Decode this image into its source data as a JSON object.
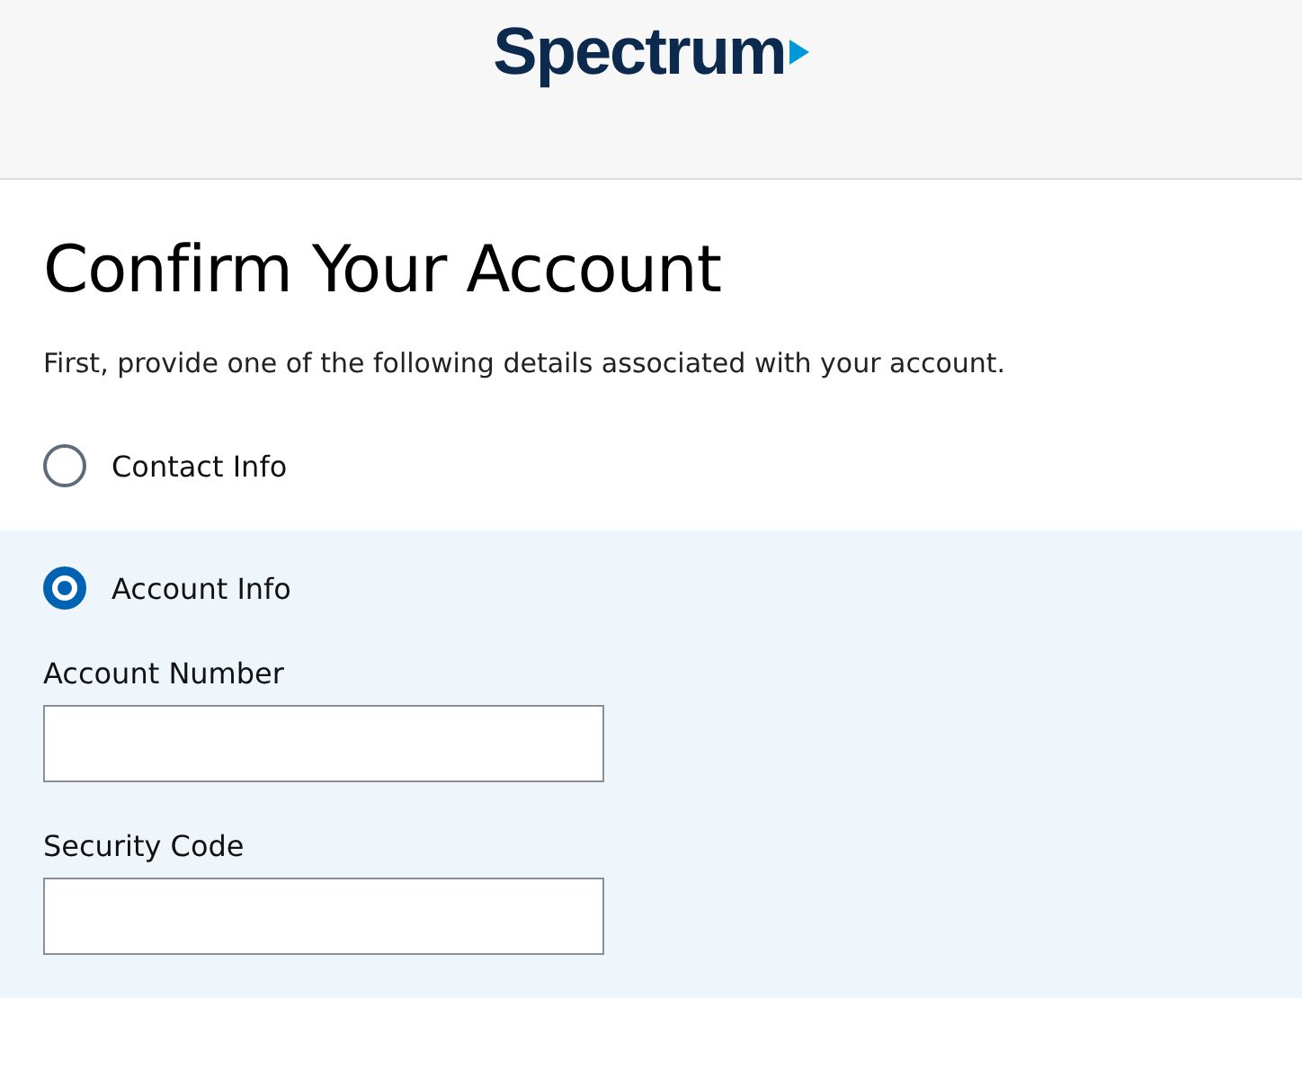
{
  "header": {
    "logo": "Spectrum"
  },
  "title": "Confirm Your Account",
  "subtitle": "First, provide one of the following details associated with your account.",
  "options": [
    {
      "label": "Contact Info",
      "selected": false
    },
    {
      "label": "Account Info",
      "selected": true,
      "fields": [
        {
          "label": "Account Number"
        },
        {
          "label": "Security Code"
        }
      ]
    }
  ]
}
